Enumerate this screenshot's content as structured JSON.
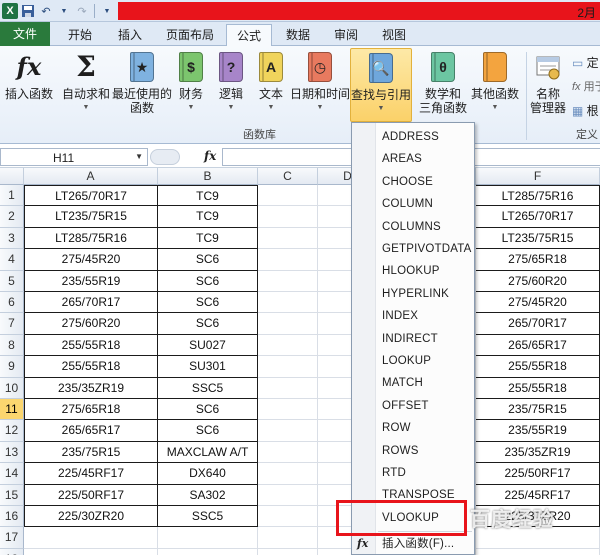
{
  "titlebar": {
    "title": "2月"
  },
  "tabs": [
    {
      "label": "文件"
    },
    {
      "label": "开始"
    },
    {
      "label": "插入"
    },
    {
      "label": "页面布局"
    },
    {
      "label": "公式"
    },
    {
      "label": "数据"
    },
    {
      "label": "审阅"
    },
    {
      "label": "视图"
    }
  ],
  "ribbon": {
    "insert_function": "插入函数",
    "autosum": "自动求和",
    "recent_line1": "最近使用的",
    "recent_line2": "函数",
    "financial": "财务",
    "logical": "逻辑",
    "text": "文本",
    "datetime": "日期和时间",
    "lookup": "查找与引用",
    "math_line1": "数学和",
    "math_line2": "三角函数",
    "more": "其他函数",
    "name_mgr_line1": "名称",
    "name_mgr_line2": "管理器",
    "define": "定",
    "use_in_formula": "用于",
    "create_from_sel": "根",
    "group_function_library": "函数库",
    "group_defined_names": "定义"
  },
  "formula_bar": {
    "name_box": "H11",
    "fx": "fx"
  },
  "grid": {
    "columns": [
      "A",
      "B",
      "C",
      "D",
      "F"
    ],
    "rows": [
      "1",
      "2",
      "3",
      "4",
      "5",
      "6",
      "7",
      "8",
      "9",
      "10",
      "11",
      "12",
      "13",
      "14",
      "15",
      "16",
      "17",
      "18"
    ],
    "colA": [
      "LT265/70R17",
      "LT235/75R15",
      "LT285/75R16",
      "275/45R20",
      "235/55R19",
      "265/70R17",
      "275/60R20",
      "255/55R18",
      "255/55R18",
      "235/35ZR19",
      "275/65R18",
      "265/65R17",
      "235/75R15",
      "225/45RF17",
      "225/50RF17",
      "225/30ZR20"
    ],
    "colB": [
      "TC9",
      "TC9",
      "TC9",
      "SC6",
      "SC6",
      "SC6",
      "SC6",
      "SU027",
      "SU301",
      "SSC5",
      "SC6",
      "SC6",
      "MAXCLAW  A/T",
      "DX640",
      "SA302",
      "SSC5"
    ],
    "colF": [
      "LT285/75R16",
      "LT265/70R17",
      "LT235/75R15",
      "275/65R18",
      "275/60R20",
      "275/45R20",
      "265/70R17",
      "265/65R17",
      "255/55R18",
      "255/55R18",
      "235/75R15",
      "235/55R19",
      "235/35ZR19",
      "225/50RF17",
      "225/45RF17",
      "225/30ZR20"
    ]
  },
  "menu": {
    "items": [
      "ADDRESS",
      "AREAS",
      "CHOOSE",
      "COLUMN",
      "COLUMNS",
      "GETPIVOTDATA",
      "HLOOKUP",
      "HYPERLINK",
      "INDEX",
      "INDIRECT",
      "LOOKUP",
      "MATCH",
      "OFFSET",
      "ROW",
      "ROWS",
      "RTD",
      "TRANSPOSE",
      "VLOOKUP"
    ],
    "footer": "插入函数(F)..."
  },
  "watermark": "百度经验"
}
